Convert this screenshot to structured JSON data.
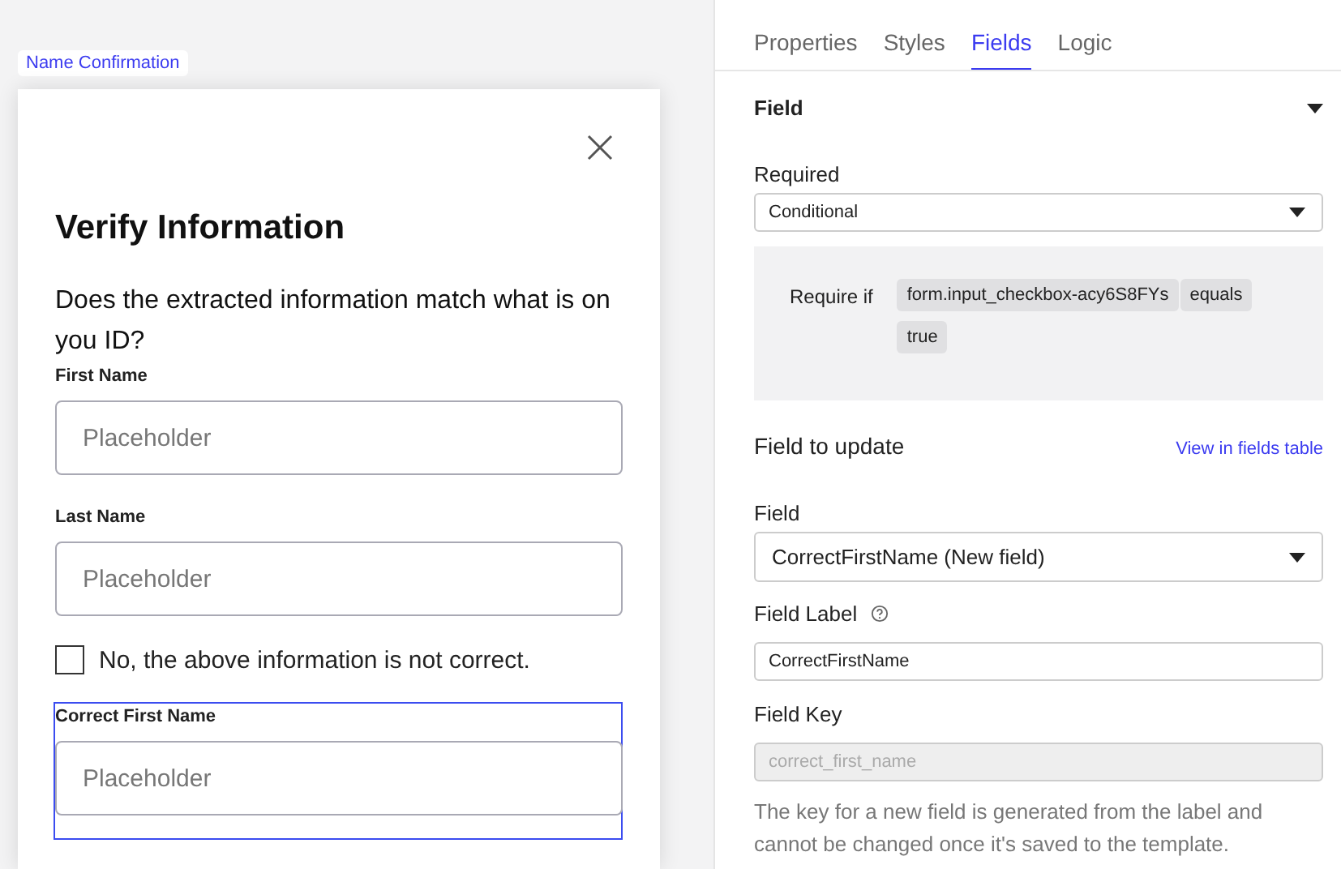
{
  "canvas": {
    "step_label": "Name Confirmation",
    "card": {
      "title": "Verify Information",
      "question": "Does the extracted information match what is on you ID?",
      "items": [
        {
          "kind": "input",
          "label": "First Name",
          "placeholder": "Placeholder",
          "selected": false
        },
        {
          "kind": "input",
          "label": "Last Name",
          "placeholder": "Placeholder",
          "selected": false
        },
        {
          "kind": "checkbox",
          "label": "No, the above information is not correct.",
          "checked": false,
          "selected": false
        },
        {
          "kind": "input",
          "label": "Correct First Name",
          "placeholder": "Placeholder",
          "selected": true
        }
      ]
    }
  },
  "panel": {
    "tabs": [
      {
        "label": "Properties",
        "selected": false
      },
      {
        "label": "Styles",
        "selected": false
      },
      {
        "label": "Fields",
        "selected": true
      },
      {
        "label": "Logic",
        "selected": false
      }
    ],
    "section": {
      "title": "Field",
      "expanded": true
    },
    "required": {
      "label": "Required",
      "value": "Conditional"
    },
    "condition": {
      "label": "Require if",
      "tokens": [
        "form.input_checkbox-acy6S8FYs",
        "equals",
        "true"
      ]
    },
    "field_to_update": {
      "title": "Field to update",
      "link": "View in fields table"
    },
    "field": {
      "label": "Field",
      "value": "CorrectFirstName (New field)"
    },
    "field_label": {
      "label": "Field Label",
      "value": "CorrectFirstName"
    },
    "field_key": {
      "label": "Field Key",
      "value": "correct_first_name",
      "disabled": true
    },
    "help": "The key for a new field is generated from the label and cannot be changed once it's saved to the template."
  }
}
